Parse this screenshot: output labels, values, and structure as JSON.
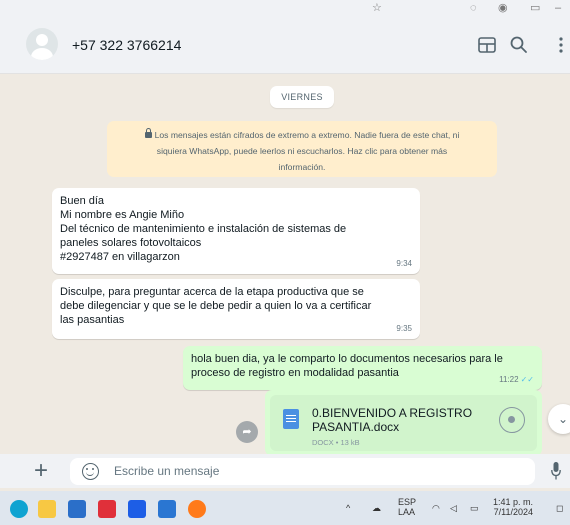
{
  "header": {
    "contact_name": "+57 322 3766214",
    "icons": [
      "avatar-icon",
      "calendar-icon",
      "search-icon",
      "menu-icon"
    ]
  },
  "chat": {
    "day_label": "VIERNES",
    "encryption_notice_lines": [
      "Los mensajes están cifrados de extremo a extremo. Nadie fuera de este chat, ni",
      "siquiera WhatsApp, puede leerlos ni escucharlos. Haz clic para obtener más",
      "información."
    ],
    "messages": [
      {
        "direction": "in",
        "lines": [
          "Buen día",
          "Mi nombre es Angie Miño",
          "Del técnico de mantenimiento e instalación de sistemas de",
          "paneles solares  fotovoltaicos",
          "#2927487 en villagarzon"
        ],
        "time": "9:34"
      },
      {
        "direction": "in",
        "lines": [
          "Disculpe, para preguntar acerca de la etapa productiva que se",
          "debe dilegenciar y que se le debe pedir a quien lo va a certificar",
          "las pasantias"
        ],
        "time": "9:35"
      },
      {
        "direction": "out",
        "lines": [
          "hola buen dia, ya le comparto lo documentos necesarios para le",
          "proceso de registro en modalidad pasantia"
        ],
        "time": "11:22",
        "ticks": "✓✓"
      }
    ],
    "file": {
      "name_lines": [
        "0.BIENVENIDO A REGISTRO",
        "PASANTIA.docx"
      ],
      "meta": "DOCX • 13 kB"
    }
  },
  "composer": {
    "placeholder": "Escribe un mensaje"
  },
  "taskbar": {
    "lang": "ESP",
    "lang_sub": "LAA",
    "clock_time": "1:41 p. m.",
    "clock_date": "7/11/2024"
  },
  "colors": {
    "header_bg": "#f0f2f5",
    "chat_bg": "#efeae2",
    "incoming_bubble": "#ffffff",
    "outgoing_bubble": "#d9fdd3",
    "encryption_notice": "#ffeecd",
    "read_ticks": "#53bdeb"
  }
}
